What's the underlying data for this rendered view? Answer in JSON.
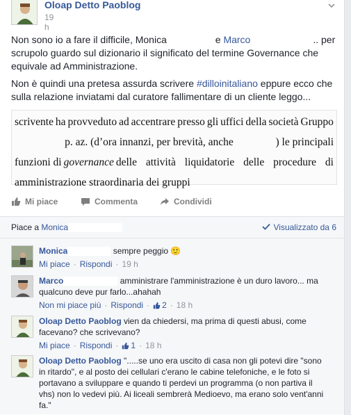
{
  "post": {
    "author": "Oloap Detto Paoblog",
    "time": "19 h",
    "paragraph1": {
      "t1": "Non sono io a fare il difficile, Monica",
      "t2": "e",
      "mention": "Marco",
      "t3": ".. per scrupolo guardo sul dizionario il significato del termine Governance che equivale ad Amministrazione."
    },
    "paragraph2": {
      "t1": "Non è quindi una pretesa assurda scrivere",
      "hashtag": "#dilloinitaliano",
      "t2": "eppure ecco che sulla relazione inviatami dal curatore fallimentare di un cliente leggo..."
    },
    "scan": {
      "line1": [
        "scrivente",
        "ha",
        "provveduto",
        "ad",
        "accentrare",
        "presso",
        "gli",
        "uffici",
        "della",
        "società",
        "Gruppo"
      ],
      "line2a": "p. az. (d’ora innanzi, per brevità, anche",
      "line2b": ") le principali",
      "line3a": "funzioni di",
      "line3em": "governance",
      "line3b": "delle attività liquidatorie delle procedure di",
      "line4": "amministrazione straordinaria dei gruppi"
    },
    "actions": {
      "like": "Mi piace",
      "comment": "Commenta",
      "share": "Condividi"
    }
  },
  "social": {
    "likes_prefix": "Piace a",
    "likes_name": "Monica",
    "seen_label": "Visualizzato da 6"
  },
  "comments": [
    {
      "name": "Monica",
      "text": "sempre peggio 🙂",
      "like_label": "Mi piace",
      "reply_label": "Rispondi",
      "time": "19 h"
    },
    {
      "name": "Marco",
      "text": "amministrare l'amministrazione è un duro lavoro... ma qualcuno deve pur farlo...ahahah",
      "like_label": "Non mi piace più",
      "reply_label": "Rispondi",
      "likes": "2",
      "time": "18 h"
    },
    {
      "name": "Oloap Detto Paoblog",
      "text": "vien da chiedersi, ma prima di questi abusi, come facevano? che scrivevano?",
      "like_label": "Mi piace",
      "reply_label": "Rispondi",
      "likes": "1",
      "time": "18 h"
    },
    {
      "name": "Oloap Detto Paoblog",
      "text": "\".....se uno era uscito di casa non gli potevi dire \"sono in ritardo\", e al posto dei cellulari c'erano le cabine telefoniche, e le foto si portavano a sviluppare e quando ti perdevi un programma (o non partiva il vhs) non lo vedevi più. Ai liceali sembrerà Medioevo, ma erano solo vent'anni fa.\""
    }
  ],
  "colors": {
    "link": "#365899",
    "meta": "#90949c",
    "background": "#e9ebee"
  }
}
